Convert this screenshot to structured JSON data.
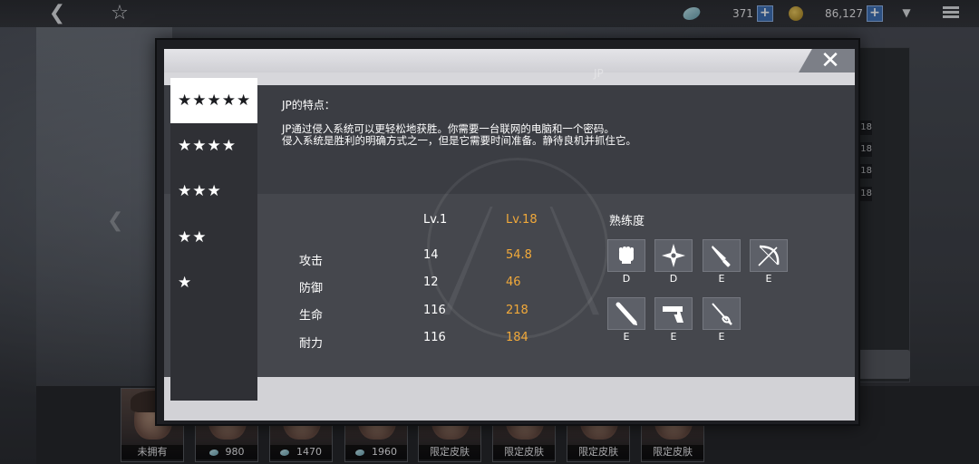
{
  "topbar": {
    "feather_amount": "371",
    "coin_amount": "86,127",
    "plus_symbol": "+"
  },
  "modal": {
    "background_code": "JP",
    "close_symbol": "✕",
    "star_tabs": [
      {
        "label": "★★★★★",
        "active": true
      },
      {
        "label": "★★★★",
        "active": false
      },
      {
        "label": "★★★",
        "active": false
      },
      {
        "label": "★★",
        "active": false
      },
      {
        "label": "★",
        "active": false
      }
    ],
    "description": {
      "title": "JP的特点：",
      "lines": [
        "JP通过侵入系统可以更轻松地获胜。你需要一台联网的电脑和一个密码。",
        "侵入系统是胜利的明确方式之一，但是它需要时间准备。静待良机并抓住它。"
      ]
    },
    "stats": {
      "header_lv1": "Lv.1",
      "header_lv18": "Lv.18",
      "rows": [
        {
          "label": "攻击",
          "lv1": "14",
          "lv18": "54.8"
        },
        {
          "label": "防御",
          "lv1": "12",
          "lv18": "46"
        },
        {
          "label": "生命",
          "lv1": "116",
          "lv18": "218"
        },
        {
          "label": "耐力",
          "lv1": "116",
          "lv18": "184"
        }
      ]
    },
    "proficiency": {
      "title": "熟练度",
      "items": [
        {
          "icon": "fist-icon",
          "grade": "D"
        },
        {
          "icon": "shuriken-icon",
          "grade": "D"
        },
        {
          "icon": "knife-icon",
          "grade": "E"
        },
        {
          "icon": "bow-icon",
          "grade": "E"
        },
        {
          "icon": "bat-icon",
          "grade": "E"
        },
        {
          "icon": "pistol-icon",
          "grade": "E"
        },
        {
          "icon": "rapier-icon",
          "grade": "E"
        }
      ]
    }
  },
  "background_right_levels": [
    "v.18",
    "v.18",
    "v.18",
    "v.18"
  ],
  "characters": [
    {
      "label": "未拥有",
      "price": false
    },
    {
      "label": "980",
      "price": true
    },
    {
      "label": "1470",
      "price": true
    },
    {
      "label": "1960",
      "price": true
    },
    {
      "label": "限定皮肤",
      "price": false
    },
    {
      "label": "限定皮肤",
      "price": false
    },
    {
      "label": "限定皮肤",
      "price": false
    },
    {
      "label": "限定皮肤",
      "price": false
    }
  ]
}
